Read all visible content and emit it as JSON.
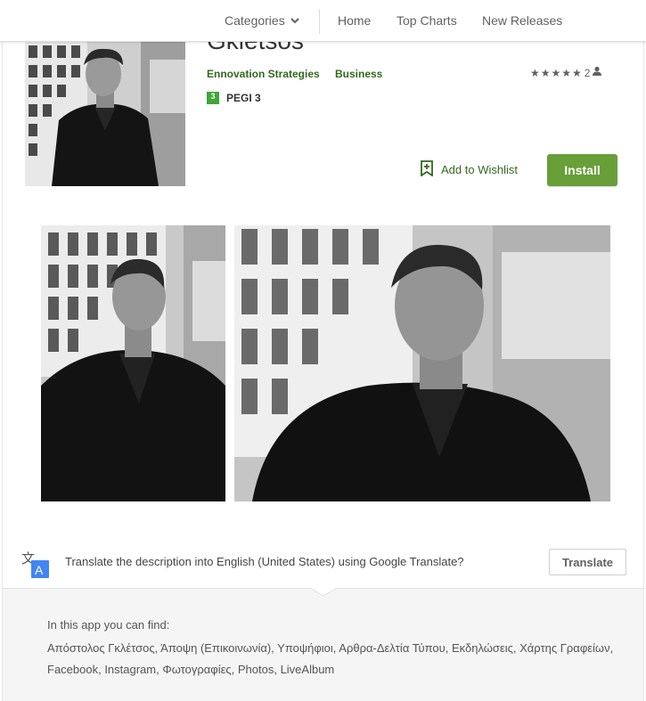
{
  "nav": {
    "categories": "Categories",
    "home": "Home",
    "top_charts": "Top Charts",
    "new_releases": "New Releases"
  },
  "app": {
    "title": "Gkletsos",
    "developer": "Ennovation Strategies",
    "category": "Business",
    "rating_count": "2",
    "stars": 5,
    "content_rating": "PEGI 3",
    "pegi_number": "3",
    "wishlist_label": "Add to Wishlist",
    "install_label": "Install"
  },
  "translate": {
    "prompt": "Translate the description into English (United States) using Google Translate?",
    "button": "Translate"
  },
  "description": {
    "intro": "In this app you can find:",
    "body": "Απόστολος Γκλέτσος, Άποψη (Επικοινωνία), Υποψήφιοι, Αρθρα-Δελτία Τύπου, Εκδηλώσεις, Χάρτης Γραφείων, Facebook, Instagram, Φωτογραφίες, Photos, LiveAlbum"
  },
  "colors": {
    "accent_green": "#689f38",
    "link_green": "#33691e",
    "translate_blue": "#4285f4"
  }
}
